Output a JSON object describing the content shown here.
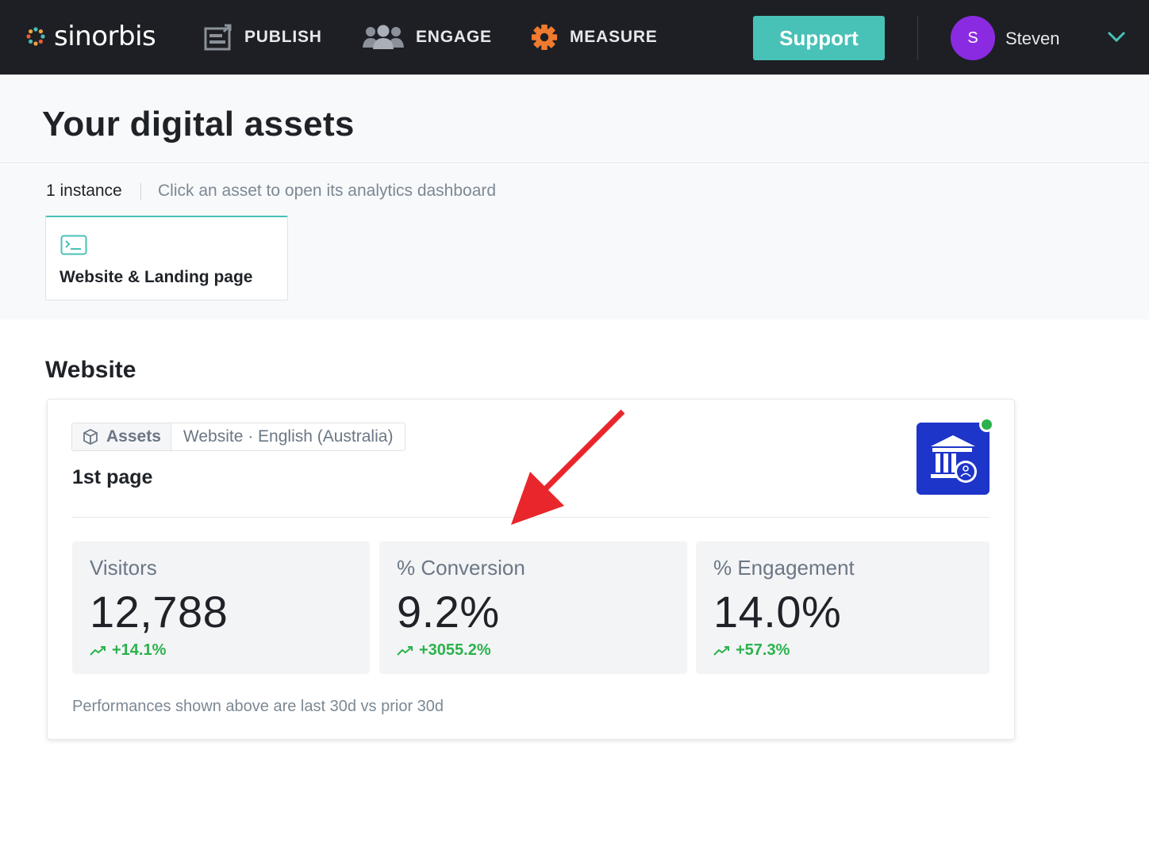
{
  "nav": {
    "brand": "sinorbis",
    "publish": "PUBLISH",
    "engage": "ENGAGE",
    "measure": "MEASURE",
    "support": "Support",
    "avatar_initial": "S",
    "user_name": "Steven"
  },
  "header": {
    "title": "Your digital assets"
  },
  "assets": {
    "instance_count": "1 instance",
    "hint": "Click an asset to open its analytics dashboard",
    "cards": [
      {
        "label": "Website & Landing page",
        "icon": "terminal-window-icon"
      }
    ]
  },
  "website": {
    "section_title": "Website",
    "crumb_tag": "Assets",
    "crumb_path": "Website · English (Australia)",
    "page_name": "1st page",
    "stats": [
      {
        "label": "Visitors",
        "value": "12,788",
        "delta": "+14.1%"
      },
      {
        "label": "% Conversion",
        "value": "9.2%",
        "delta": "+3055.2%"
      },
      {
        "label": "% Engagement",
        "value": "14.0%",
        "delta": "+57.3%"
      }
    ],
    "footnote": "Performances shown above are last 30d vs prior 30d"
  },
  "colors": {
    "topbar": "#1d1f24",
    "accent": "#48c1b7",
    "avatar": "#8a2be2",
    "positive": "#2bb24c",
    "logo_bg": "#1e35c9",
    "annotation_arrow": "#e8262b"
  }
}
